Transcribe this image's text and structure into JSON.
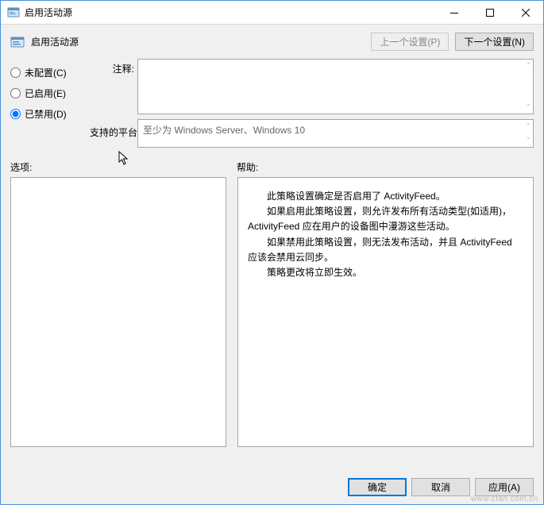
{
  "window": {
    "title": "启用活动源"
  },
  "header": {
    "policy_name": "启用活动源",
    "prev_setting": "上一个设置(P)",
    "next_setting": "下一个设置(N)"
  },
  "config": {
    "radios": {
      "not_configured": "未配置(C)",
      "enabled": "已启用(E)",
      "disabled": "已禁用(D)",
      "selected": "disabled"
    },
    "comment_label": "注释:",
    "comment_value": "",
    "platform_label": "支持的平台:",
    "platform_value": "至少为 Windows Server、Windows 10"
  },
  "sections": {
    "options_label": "选项:",
    "help_label": "帮助:"
  },
  "help": {
    "l1": "此策略设置确定是否启用了 ActivityFeed。",
    "l2": "如果启用此策略设置，则允许发布所有活动类型(如适用)，ActivityFeed 应在用户的设备图中漫游这些活动。",
    "l3": "如果禁用此策略设置，则无法发布活动，并且 ActivityFeed 应该会禁用云同步。",
    "l4": "策略更改将立即生效。"
  },
  "footer": {
    "ok": "确定",
    "cancel": "取消",
    "apply": "应用(A)"
  },
  "watermark": "www.cfan.com.cn"
}
